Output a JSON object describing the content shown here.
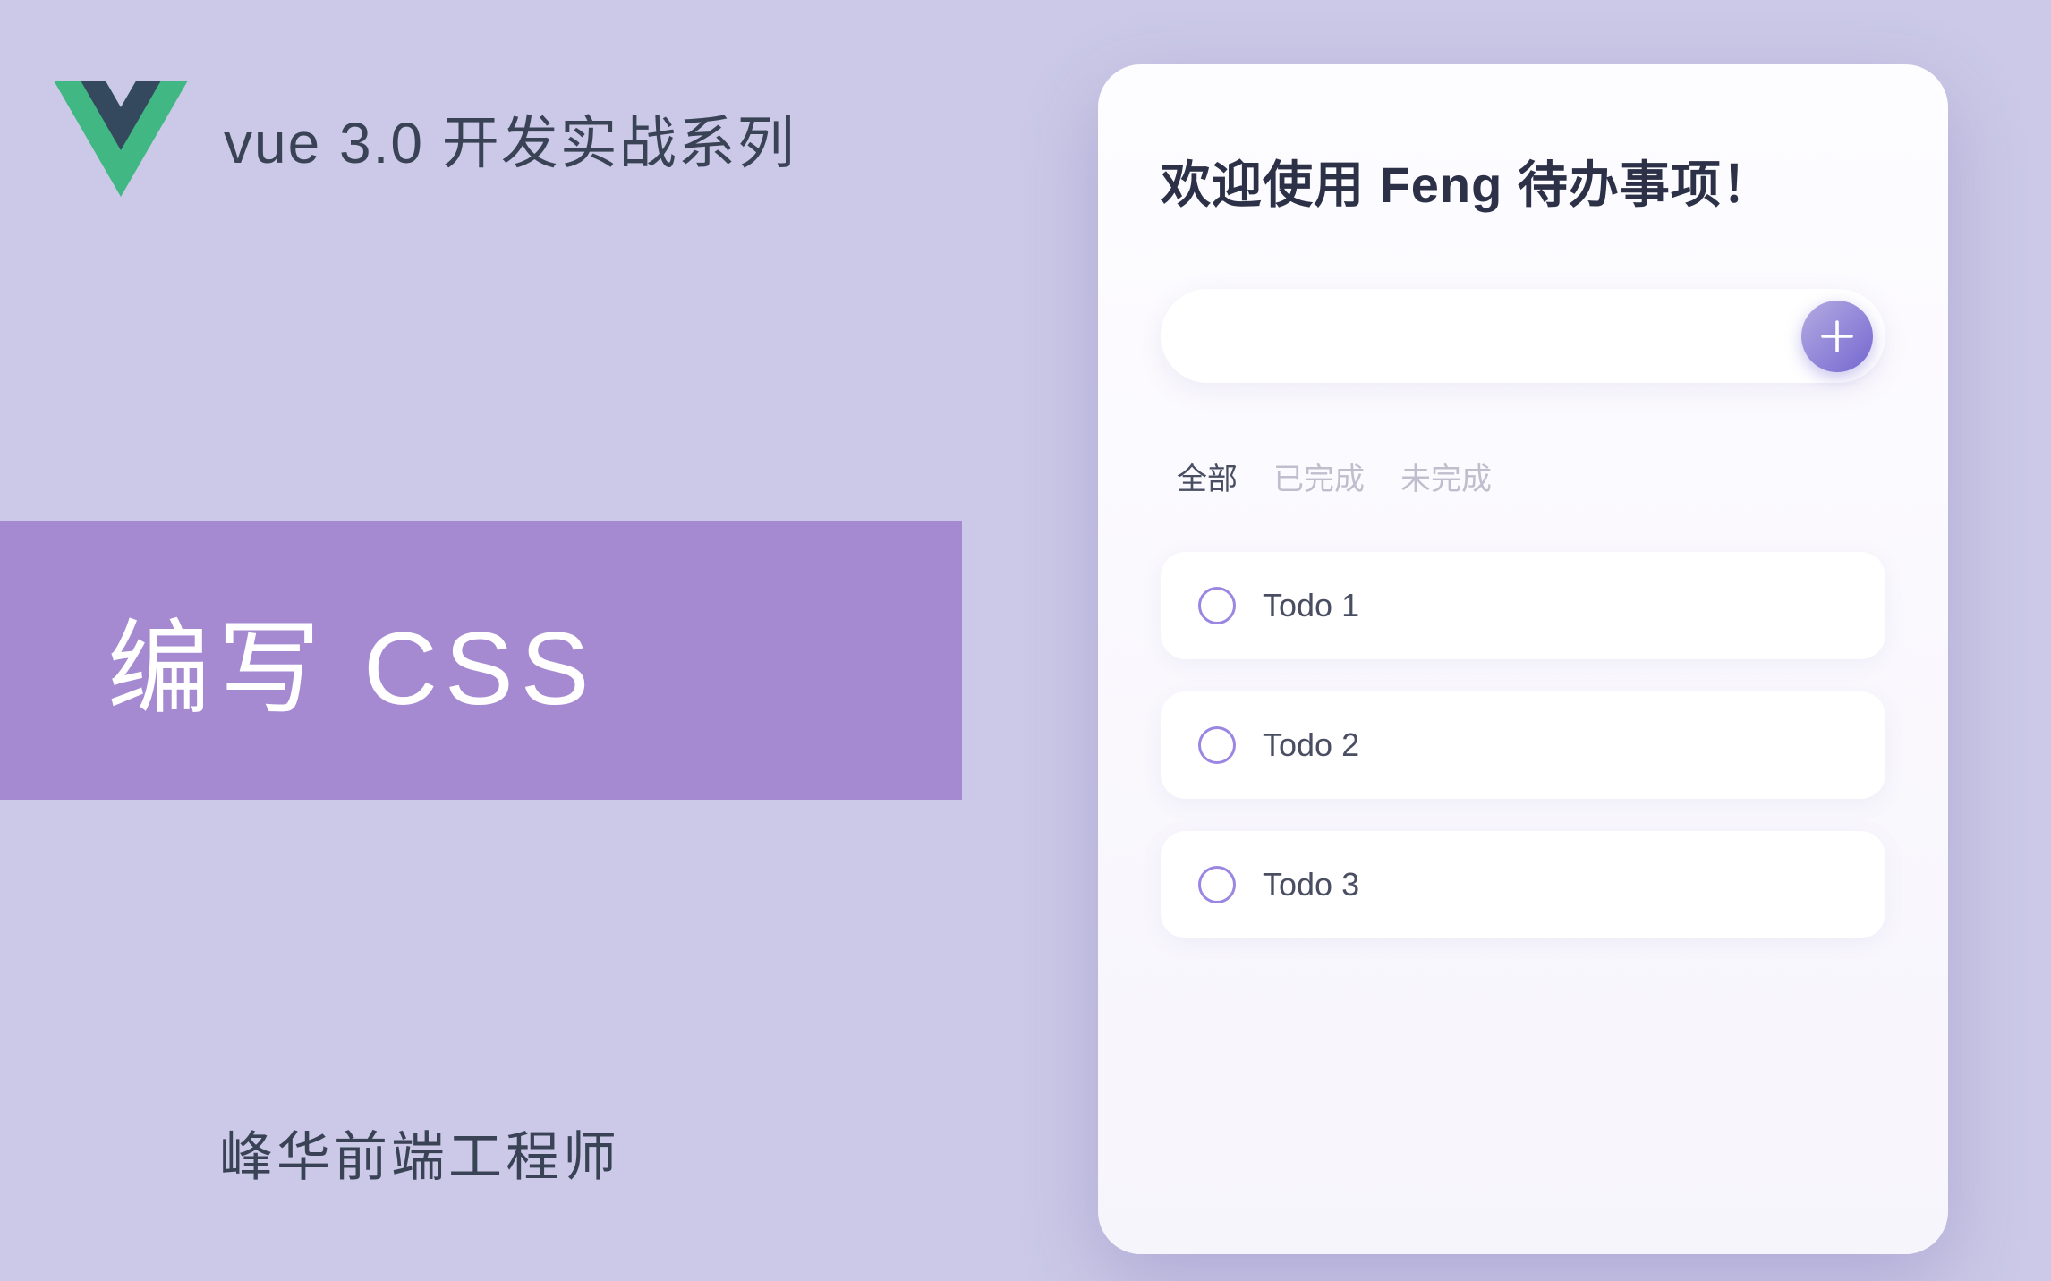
{
  "header": {
    "series_title": "vue 3.0 开发实战系列"
  },
  "topic": {
    "title": "编写 CSS"
  },
  "author": "峰华前端工程师",
  "app": {
    "title": "欢迎使用 Feng 待办事项！",
    "input": {
      "value": "",
      "placeholder": ""
    },
    "filters": [
      {
        "label": "全部",
        "active": true
      },
      {
        "label": "已完成",
        "active": false
      },
      {
        "label": "未完成",
        "active": false
      }
    ],
    "todos": [
      {
        "label": "Todo 1",
        "done": false
      },
      {
        "label": "Todo 2",
        "done": false
      },
      {
        "label": "Todo 3",
        "done": false
      }
    ]
  },
  "colors": {
    "background": "#cbc9e7",
    "band": "#a58ad1",
    "accent_start": "#b4abe2",
    "accent_end": "#7467d0",
    "text_dark": "#2c3147"
  }
}
